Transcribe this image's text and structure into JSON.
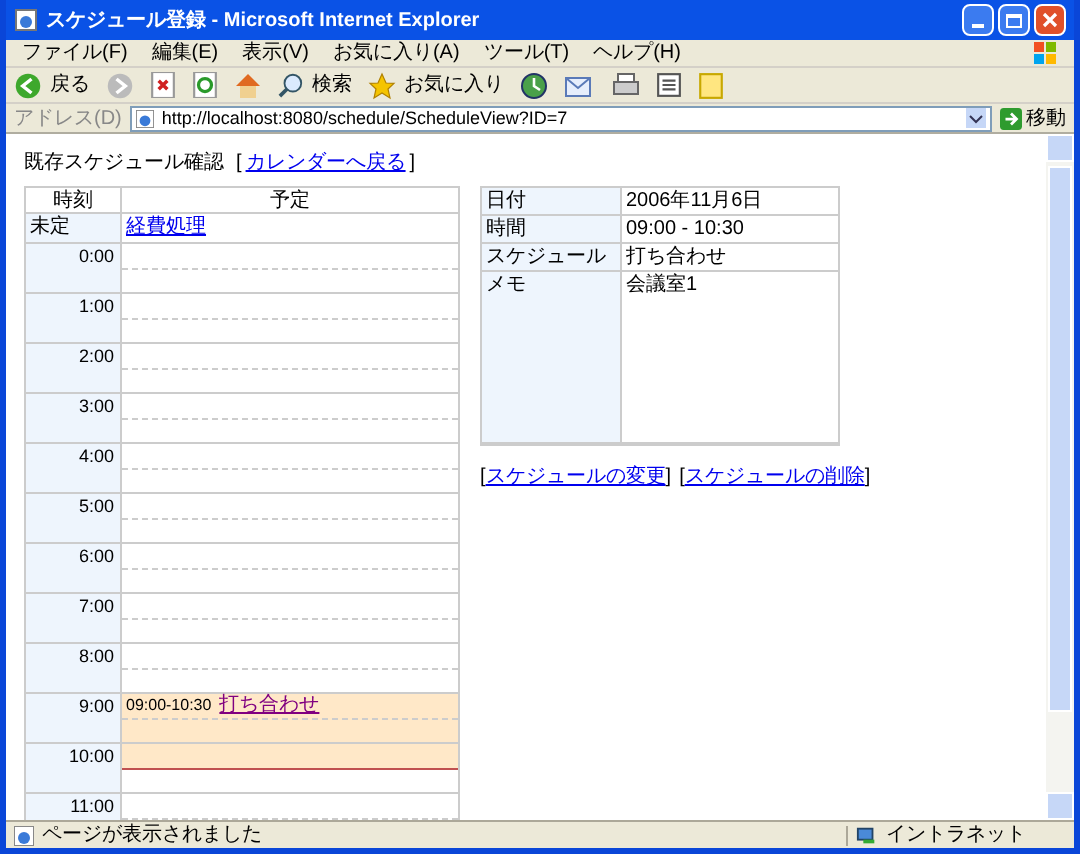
{
  "window": {
    "title": "スケジュール登録 - Microsoft Internet Explorer"
  },
  "menu": [
    "ファイル(F)",
    "編集(E)",
    "表示(V)",
    "お気に入り(A)",
    "ツール(T)",
    "ヘルプ(H)"
  ],
  "toolbar": {
    "back": "戻る",
    "search": "検索",
    "favorites": "お気に入り"
  },
  "address": {
    "label": "アドレス(D)",
    "url": "http://localhost:8080/schedule/ScheduleView?ID=7",
    "go": "移動"
  },
  "page": {
    "heading": "既存スケジュール確認",
    "back_link": {
      "open": "[",
      "text": "カレンダーへ戻る",
      "close": "]"
    },
    "schedule_table": {
      "columns": [
        "時刻",
        "予定"
      ],
      "unscheduled": {
        "label": "未定",
        "link": "経費処理"
      },
      "hours": [
        {
          "label": "0:00",
          "booked": [
            false,
            false
          ]
        },
        {
          "label": "1:00",
          "booked": [
            false,
            false
          ]
        },
        {
          "label": "2:00",
          "booked": [
            false,
            false
          ]
        },
        {
          "label": "3:00",
          "booked": [
            false,
            false
          ]
        },
        {
          "label": "4:00",
          "booked": [
            false,
            false
          ]
        },
        {
          "label": "5:00",
          "booked": [
            false,
            false
          ]
        },
        {
          "label": "6:00",
          "booked": [
            false,
            false
          ]
        },
        {
          "label": "7:00",
          "booked": [
            false,
            false
          ]
        },
        {
          "label": "8:00",
          "booked": [
            false,
            false
          ]
        },
        {
          "label": "9:00",
          "booked": [
            true,
            true
          ],
          "event": {
            "time": "09:00-10:30",
            "title": "打ち合わせ"
          }
        },
        {
          "label": "10:00",
          "booked": [
            true,
            false
          ]
        },
        {
          "label": "11:00",
          "booked": [
            false,
            false
          ]
        }
      ]
    },
    "details": [
      {
        "label": "日付",
        "value": "2006年11月6日"
      },
      {
        "label": "時間",
        "value": "09:00 - 10:30"
      },
      {
        "label": "スケジュール",
        "value": "打ち合わせ"
      },
      {
        "label": "メモ",
        "value": "会議室1",
        "tall": true
      }
    ],
    "actions": [
      {
        "open": "[",
        "text": "スケジュールの変更",
        "close": "]"
      },
      {
        "open": "[",
        "text": "スケジュールの削除",
        "close": "]"
      }
    ]
  },
  "status_bar": {
    "text": "ページが表示されました",
    "zone": "イントラネット"
  }
}
